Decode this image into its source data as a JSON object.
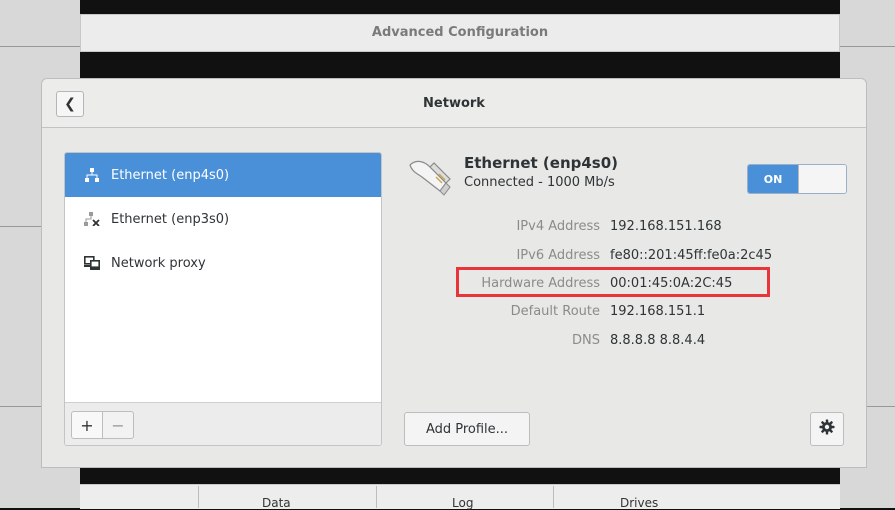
{
  "background_window": {
    "title": "Advanced Configuration",
    "columns": [
      "Data",
      "Log",
      "Drives"
    ]
  },
  "dialog": {
    "title": "Network",
    "back_icon": "chevron-left-icon"
  },
  "sidebar": {
    "items": [
      {
        "label": "Ethernet (enp4s0)",
        "icon": "network-wired-icon",
        "selected": true
      },
      {
        "label": "Ethernet (enp3s0)",
        "icon": "network-disconnected-icon",
        "selected": false
      },
      {
        "label": "Network proxy",
        "icon": "network-proxy-icon",
        "selected": false
      }
    ],
    "add_label": "+",
    "remove_label": "−"
  },
  "details": {
    "name": "Ethernet (enp4s0)",
    "status": "Connected - 1000 Mb/s",
    "toggle_label": "ON",
    "rows": [
      {
        "label": "IPv4 Address",
        "value": "192.168.151.168"
      },
      {
        "label": "IPv6 Address",
        "value": "fe80::201:45ff:fe0a:2c45"
      },
      {
        "label": "Hardware Address",
        "value": "00:01:45:0A:2C:45"
      },
      {
        "label": "Default Route",
        "value": "192.168.151.1"
      },
      {
        "label": "DNS",
        "value": "8.8.8.8 8.8.4.4"
      }
    ],
    "add_profile_label": "Add Profile...",
    "settings_icon": "gear-icon"
  },
  "colors": {
    "accent": "#4a90d9",
    "highlight": "#e8353b"
  }
}
